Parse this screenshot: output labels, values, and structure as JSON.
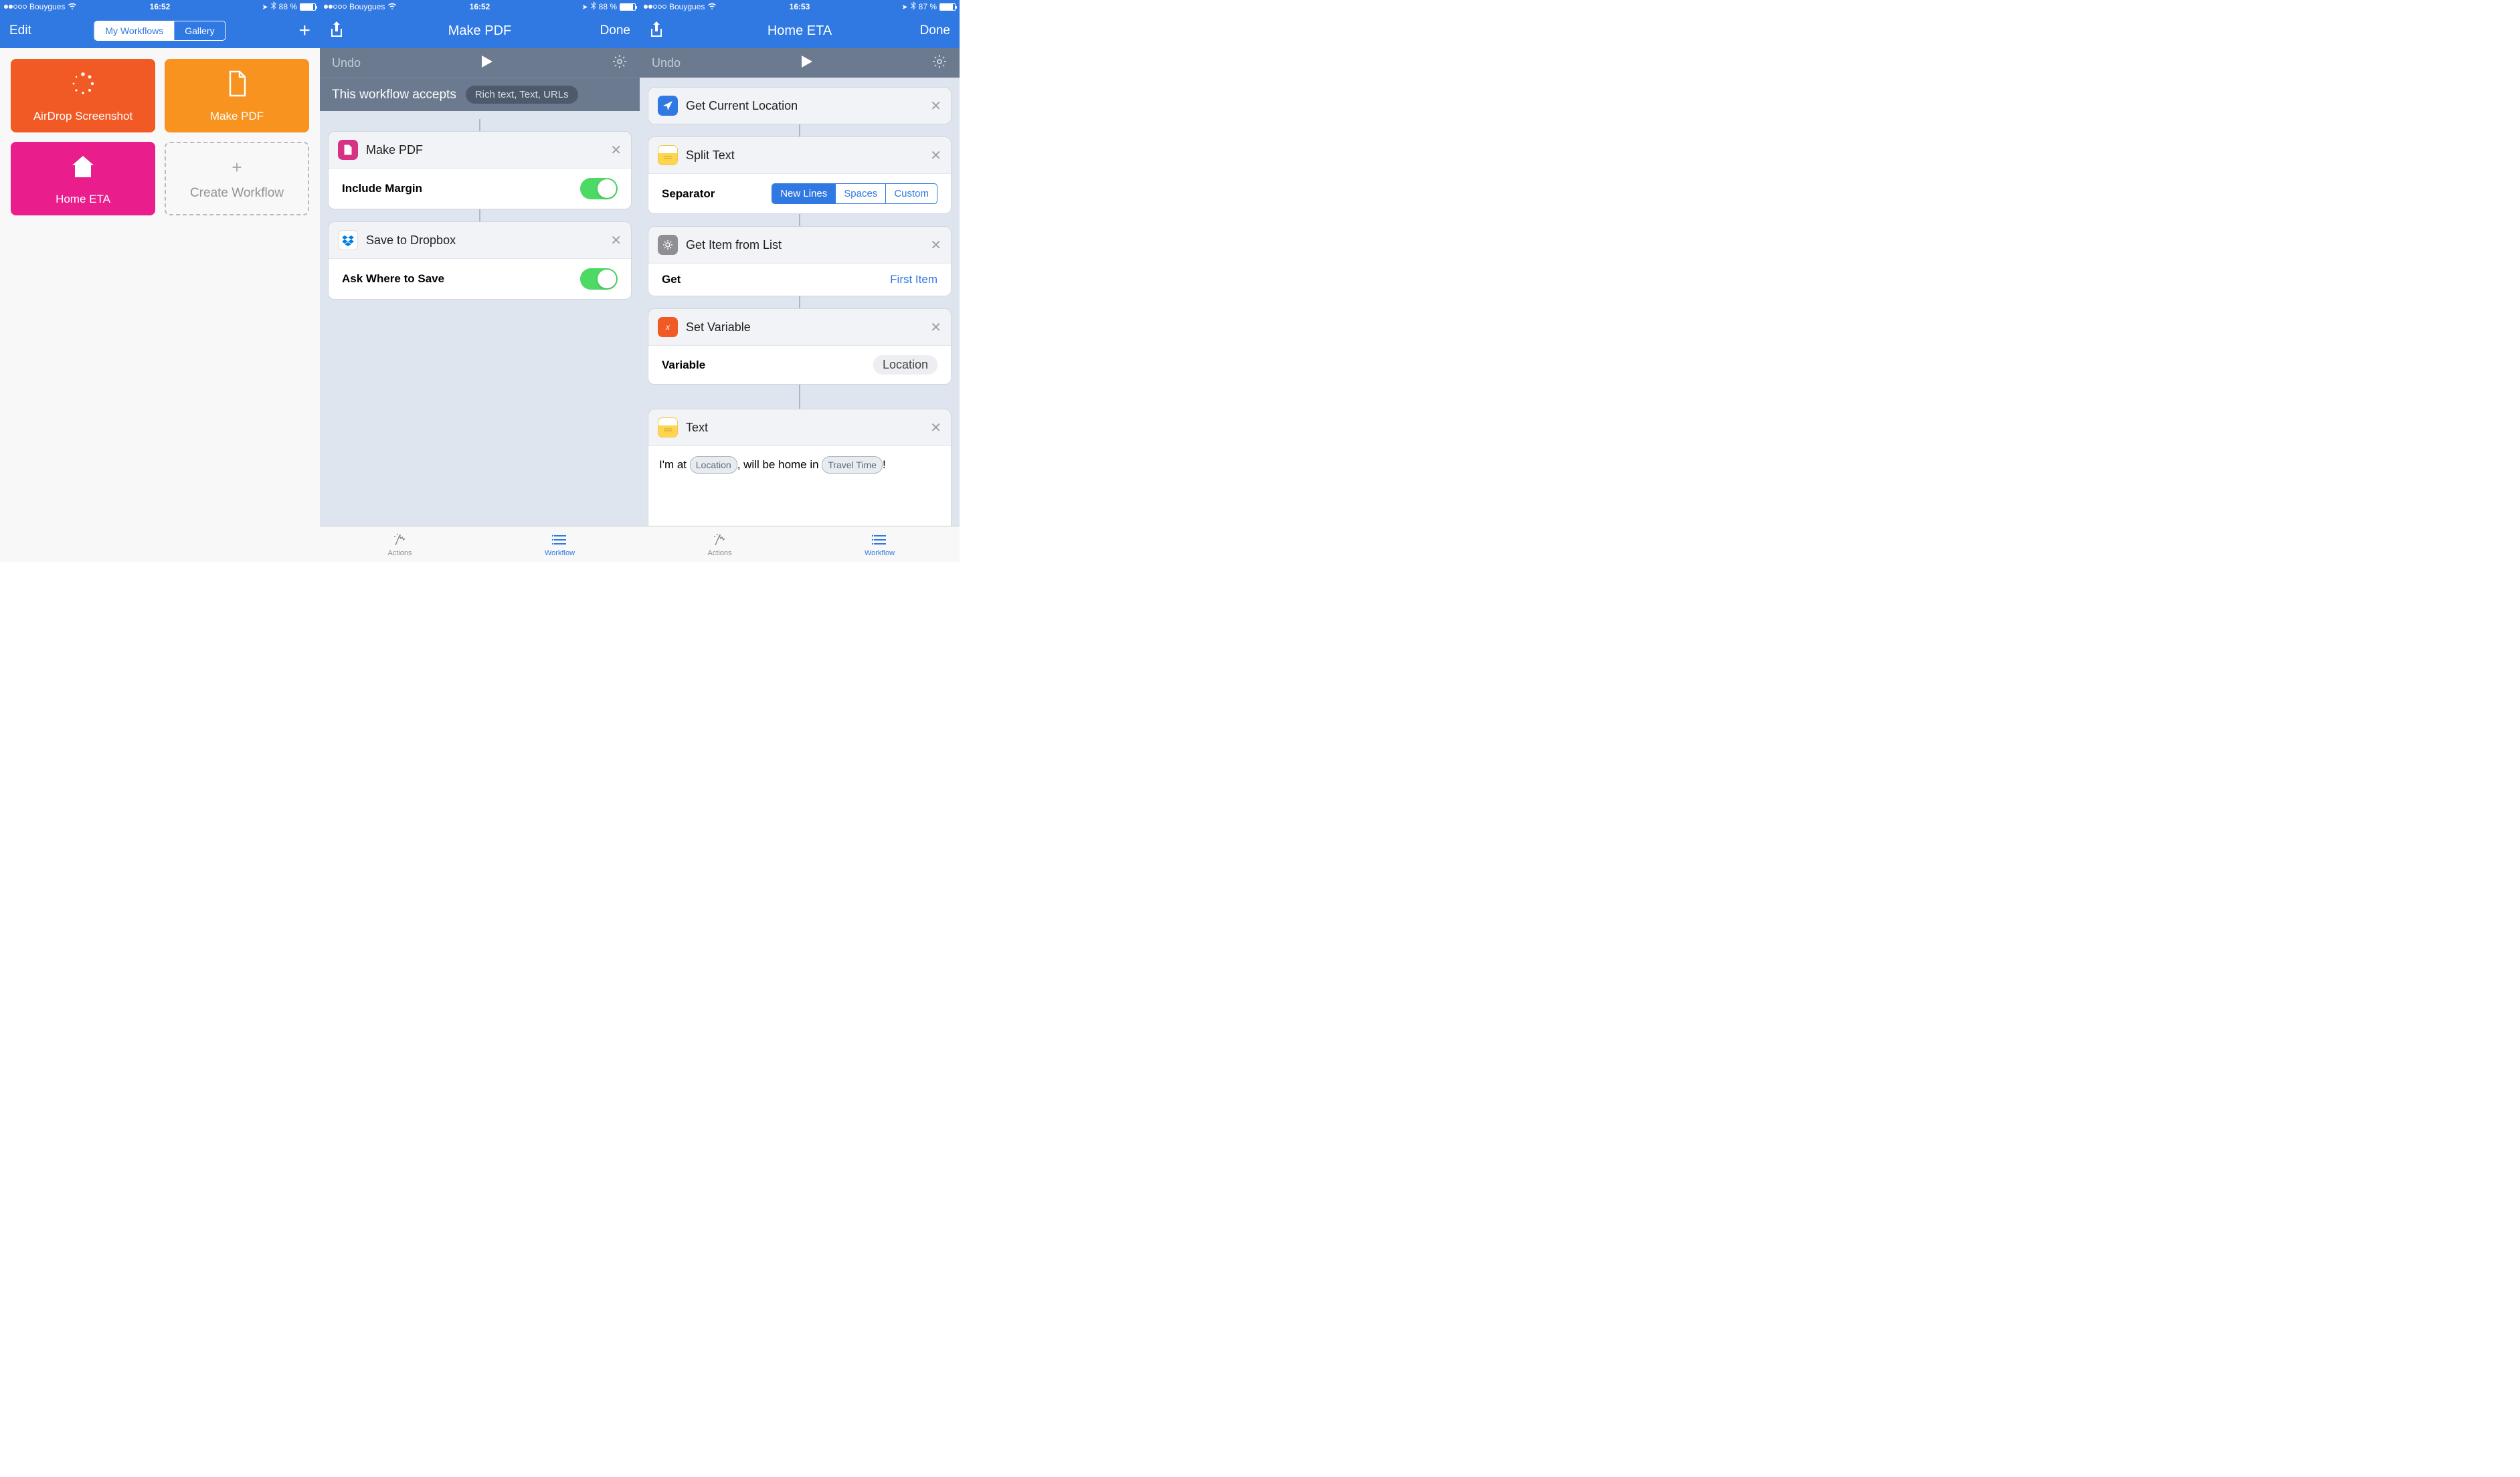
{
  "screens": [
    {
      "status": {
        "carrier": "Bouygues",
        "time": "16:52",
        "battery_pct": "88 %"
      },
      "nav": {
        "left": "Edit",
        "seg_a": "My Workflows",
        "seg_b": "Gallery",
        "seg_active": "a"
      },
      "tiles": [
        {
          "label": "AirDrop Screenshot",
          "color": "orange",
          "icon": "dots"
        },
        {
          "label": "Make PDF",
          "color": "lightorange",
          "icon": "file"
        },
        {
          "label": "Home ETA",
          "color": "pink",
          "icon": "home"
        },
        {
          "label": "Create Workflow",
          "dashed": true
        }
      ]
    },
    {
      "status": {
        "carrier": "Bouygues",
        "time": "16:52",
        "battery_pct": "88 %"
      },
      "nav": {
        "title": "Make PDF",
        "right": "Done"
      },
      "toolbar_undo": "Undo",
      "accepts_label": "This workflow accepts",
      "accepts_value": "Rich text, Text, URLs",
      "actions": [
        {
          "title": "Make PDF",
          "icon": "magenta",
          "row_label": "Include Margin",
          "switch": true
        },
        {
          "title": "Save to Dropbox",
          "icon": "dropbox",
          "row_label": "Ask Where to Save",
          "switch": true
        }
      ],
      "tabs": {
        "a": "Actions",
        "b": "Workflow",
        "active": "b"
      }
    },
    {
      "status": {
        "carrier": "Bouygues",
        "time": "16:53",
        "battery_pct": "87 %"
      },
      "nav": {
        "title": "Home ETA",
        "right": "Done"
      },
      "toolbar_undo": "Undo",
      "actions": [
        {
          "title": "Get Current Location",
          "icon": "blue-loc"
        },
        {
          "title": "Split Text",
          "icon": "yellow",
          "row_label": "Separator",
          "segmented": [
            "New Lines",
            "Spaces",
            "Custom"
          ],
          "seg_active": 0
        },
        {
          "title": "Get Item from List",
          "icon": "gray-gear",
          "row_label": "Get",
          "value_link": "First Item"
        },
        {
          "title": "Set Variable",
          "icon": "orange-x",
          "row_label": "Variable",
          "var_pill": "Location"
        },
        {
          "title": "Text",
          "icon": "yellow",
          "text_row": {
            "pre": "I'm at ",
            "tok1": "Location",
            "mid": ", will be home in ",
            "tok2": "Travel Time",
            "post": "!"
          }
        }
      ],
      "tabs": {
        "a": "Actions",
        "b": "Workflow",
        "active": "b"
      }
    }
  ]
}
